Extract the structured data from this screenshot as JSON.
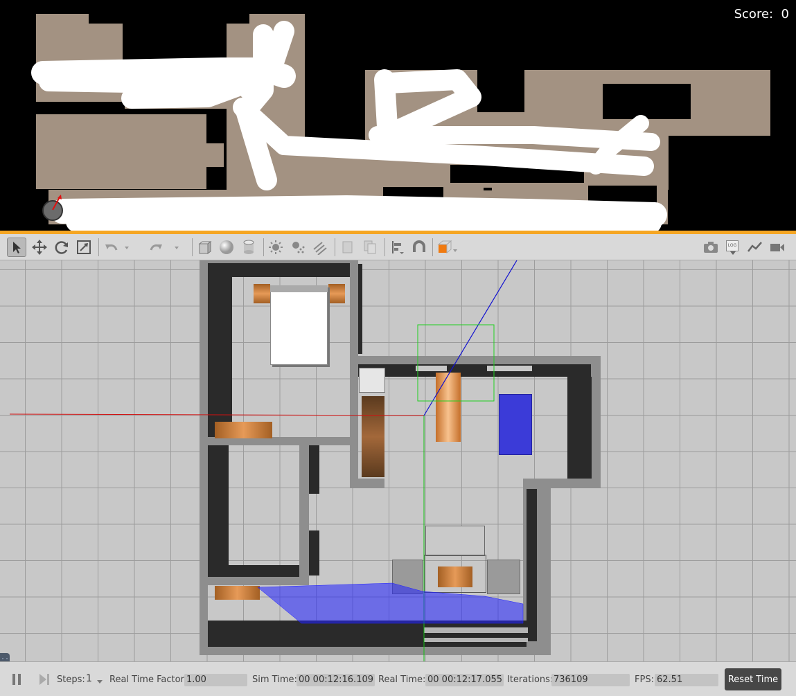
{
  "map": {
    "score_label": "Score:",
    "score_value": "0",
    "colors": {
      "background": "#000000",
      "floor": "#a39282",
      "path": "#ffffff",
      "divider": "#f5a623",
      "robot_heading": "#e01010"
    },
    "robot_icon": "robot-icon"
  },
  "toolbar": {
    "tools": [
      {
        "name": "select-mode-button",
        "icon": "arrow-cursor-icon"
      },
      {
        "name": "translate-mode-button",
        "icon": "move-arrows-icon"
      },
      {
        "name": "rotate-mode-button",
        "icon": "rotate-icon"
      },
      {
        "name": "scale-mode-button",
        "icon": "scale-icon"
      },
      {
        "name": "undo-button",
        "icon": "undo-icon"
      },
      {
        "name": "redo-button",
        "icon": "redo-icon"
      },
      {
        "name": "box-shape-button",
        "icon": "box-icon"
      },
      {
        "name": "sphere-shape-button",
        "icon": "sphere-icon"
      },
      {
        "name": "cylinder-shape-button",
        "icon": "cylinder-icon"
      },
      {
        "name": "point-light-button",
        "icon": "point-light-icon"
      },
      {
        "name": "spot-light-button",
        "icon": "spot-light-icon"
      },
      {
        "name": "directional-light-button",
        "icon": "directional-light-icon"
      },
      {
        "name": "copy-button",
        "icon": "copy-icon"
      },
      {
        "name": "paste-button",
        "icon": "paste-icon"
      },
      {
        "name": "align-button",
        "icon": "align-icon"
      },
      {
        "name": "snap-button",
        "icon": "magnet-icon"
      },
      {
        "name": "view-angle-button",
        "icon": "view-cube-icon"
      },
      {
        "name": "screenshot-button",
        "icon": "camera-icon"
      },
      {
        "name": "log-button",
        "icon": "log-icon"
      },
      {
        "name": "plot-button",
        "icon": "plot-icon"
      },
      {
        "name": "video-record-button",
        "icon": "video-camera-icon"
      }
    ],
    "log_text": "LOG"
  },
  "status": {
    "steps_label": "Steps:",
    "steps_value": "1",
    "rtf_label": "Real Time Factor:",
    "rtf_value": "1.00",
    "sim_time_label": "Sim Time:",
    "sim_time_value": "00 00:12:16.109",
    "real_time_label": "Real Time:",
    "real_time_value": "00 00:12:17.055",
    "iterations_label": "Iterations:",
    "iterations_value": "736109",
    "fps_label": "FPS:",
    "fps_value": "62.51",
    "reset_label": "Reset Time"
  }
}
